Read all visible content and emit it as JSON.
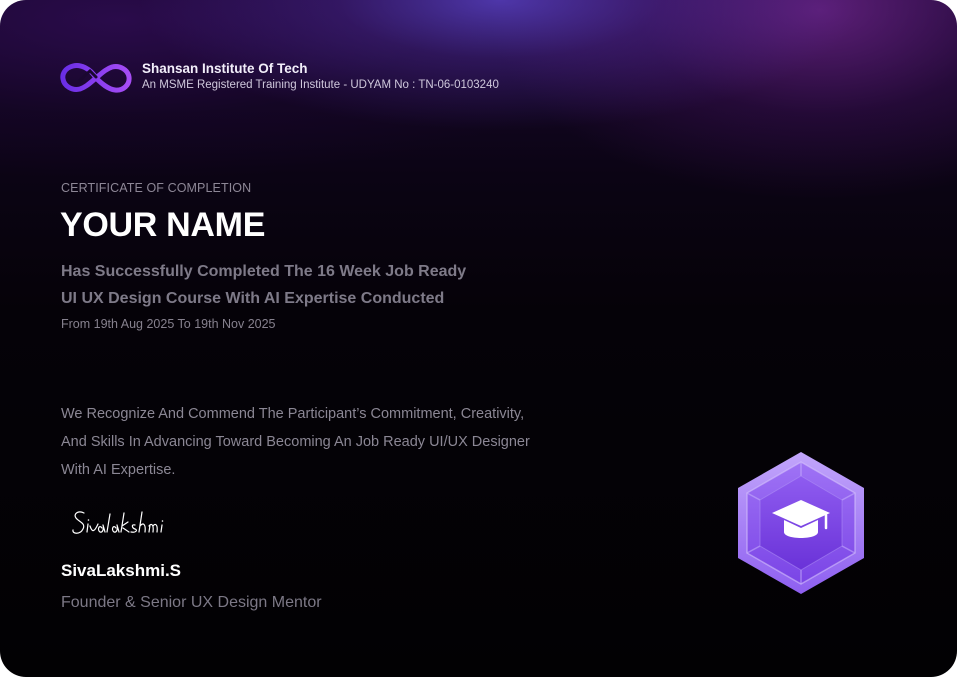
{
  "institute": {
    "name": "Shansan Institute Of Tech",
    "registration": "An MSME Registered Training Institute - UDYAM No : TN-06-0103240"
  },
  "certificate": {
    "label": "CERTIFICATE OF COMPLETION",
    "recipient": "YOUR NAME",
    "course_lines": [
      "Has Successfully Completed The 16 Week Job Ready",
      "UI UX Design Course With AI Expertise Conducted"
    ],
    "dates": "From 19th Aug 2025 To 19th Nov 2025",
    "recognition_lines": [
      "We Recognize And Commend The Participant’s Commitment, Creativity,",
      "And Skills In Advancing Toward Becoming An Job Ready UI/UX Designer",
      "With AI Expertise."
    ]
  },
  "signatory": {
    "signature_text": "Sivalakshmi",
    "name": "SivaLakshmi.S",
    "title": "Founder & Senior UX Design Mentor"
  },
  "colors": {
    "brand_purple": "#8b3ff0",
    "badge_light": "#b89af7",
    "background": "#050208"
  },
  "icons": [
    "infinity-logo-icon",
    "graduation-cap-icon"
  ]
}
